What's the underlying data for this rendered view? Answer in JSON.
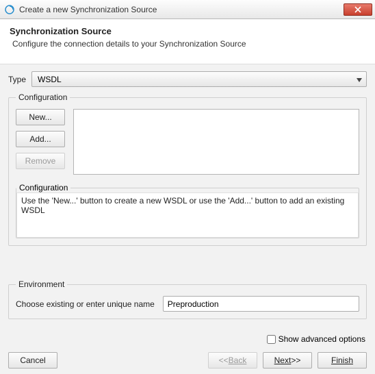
{
  "window": {
    "title": "Create a new Synchronization Source"
  },
  "header": {
    "title": "Synchronization Source",
    "subtitle": "Configure the connection details to your Synchronization Source"
  },
  "type": {
    "label": "Type",
    "value": "WSDL"
  },
  "config": {
    "legend": "Configuration",
    "new_label": "New...",
    "add_label": "Add...",
    "remove_label": "Remove",
    "info_legend": "Configuration",
    "info_text": "Use the 'New...' button to create a new WSDL or use the 'Add...' button to add an existing WSDL"
  },
  "environment": {
    "legend": "Environment",
    "prompt": "Choose existing or enter unique name",
    "value": "Preproduction"
  },
  "advanced": {
    "label": "Show advanced options"
  },
  "buttons": {
    "cancel": "Cancel",
    "back": "Back",
    "next": "Next",
    "finish": "Finish"
  }
}
